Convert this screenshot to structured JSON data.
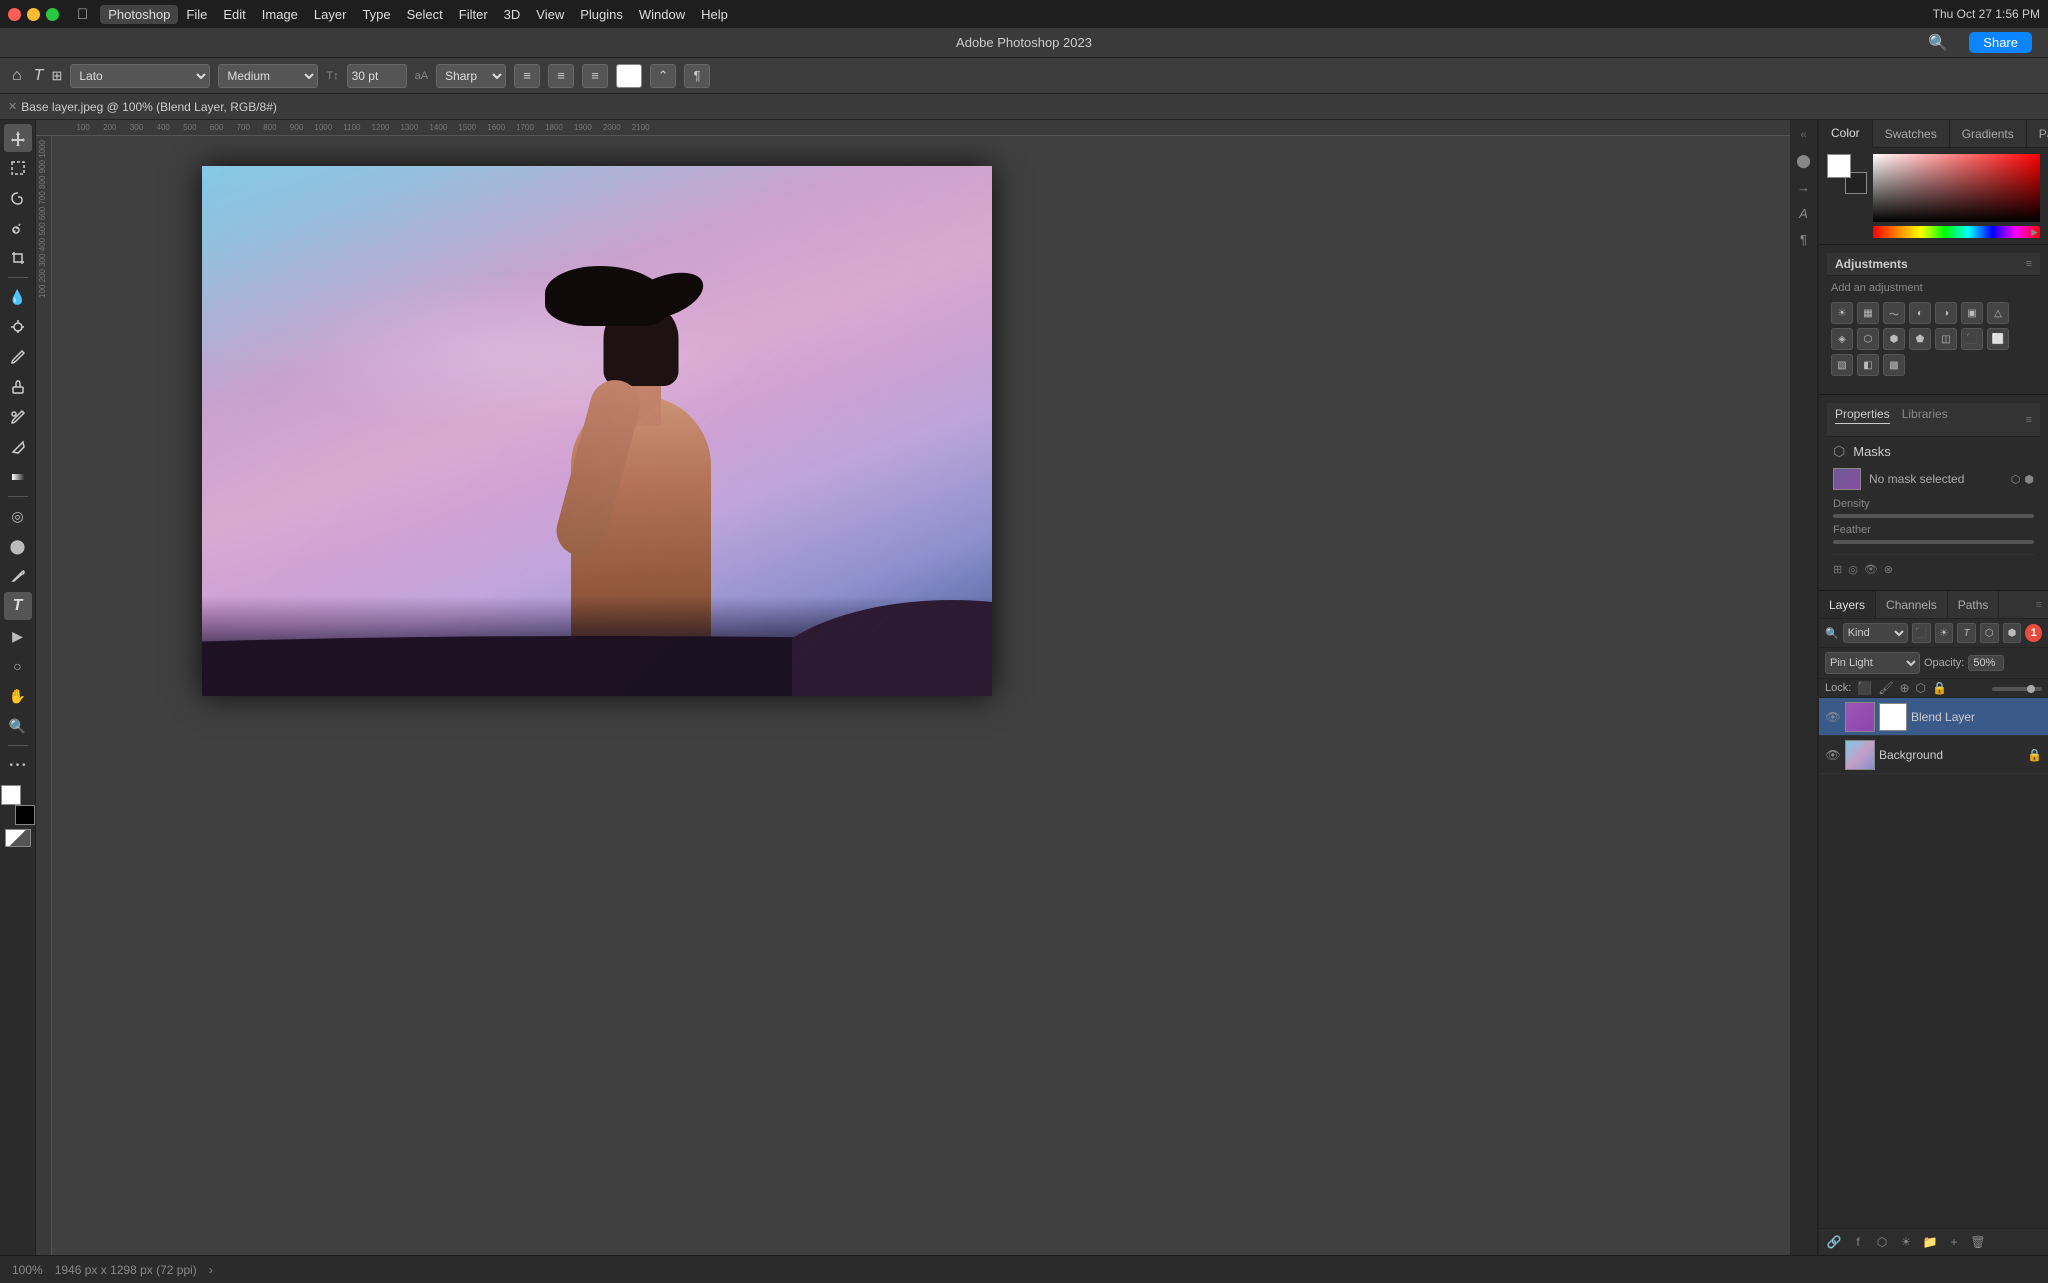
{
  "app": {
    "title": "Adobe Photoshop 2023",
    "doc_title": "Base layer.jpeg @ 100% (Blend Layer, RGB/8#)",
    "status_zoom": "100%",
    "status_dims": "1946 px x 1298 px (72 ppi)",
    "status_arrow": ">"
  },
  "menubar": {
    "apple": "",
    "items": [
      "Photoshop",
      "File",
      "Edit",
      "Image",
      "Layer",
      "Type",
      "Select",
      "Filter",
      "3D",
      "View",
      "Plugins",
      "Window",
      "Help"
    ]
  },
  "toolbar": {
    "home_icon": "⌂",
    "font_family": "Lato",
    "font_weight": "Medium",
    "font_size": "30 pt",
    "aa_mode": "Sharp",
    "share_label": "Share"
  },
  "options_bar": {
    "font_placeholder": "Lato",
    "weight_placeholder": "Medium",
    "size_value": "30 pt",
    "aa_value": "Sharp",
    "align_left": "≡",
    "align_center": "≡",
    "align_right": "≡",
    "warp_icon": "⌃",
    "cancel_icon": "✕",
    "commit_icon": "✓"
  },
  "color_panel": {
    "tabs": [
      "Color",
      "Swatches",
      "Gradients",
      "Patterns"
    ]
  },
  "adjustments": {
    "title": "Adjustments",
    "subtitle": "Add an adjustment",
    "icons": [
      "☀",
      "◐",
      "◑",
      "▦",
      "▣",
      "△",
      "◈",
      "⬡",
      "⬢",
      "⬟",
      "◫",
      "⬛",
      "⬜",
      "▧",
      "◧",
      "▩"
    ]
  },
  "properties": {
    "tabs": [
      "Properties",
      "Libraries"
    ],
    "masks_label": "Masks",
    "no_mask_label": "No mask selected",
    "density_label": "Density",
    "feather_label": "Feather"
  },
  "layers": {
    "tabs": [
      "Layers",
      "Channels",
      "Paths"
    ],
    "filter_label": "Kind",
    "blend_mode": "Pin Light",
    "opacity_label": "Opacity:",
    "opacity_value": "50%",
    "lock_label": "Lock:",
    "notification_count": "1",
    "items": [
      {
        "name": "Blend Layer",
        "visible": true,
        "has_color_thumb": true,
        "has_mask": true,
        "active": true
      },
      {
        "name": "Background",
        "visible": true,
        "has_color_thumb": false,
        "has_mask": false,
        "locked": true,
        "active": false
      }
    ]
  },
  "status_bar": {
    "zoom": "100%",
    "dims": "1946 px x 1298 px (72 ppi)"
  }
}
